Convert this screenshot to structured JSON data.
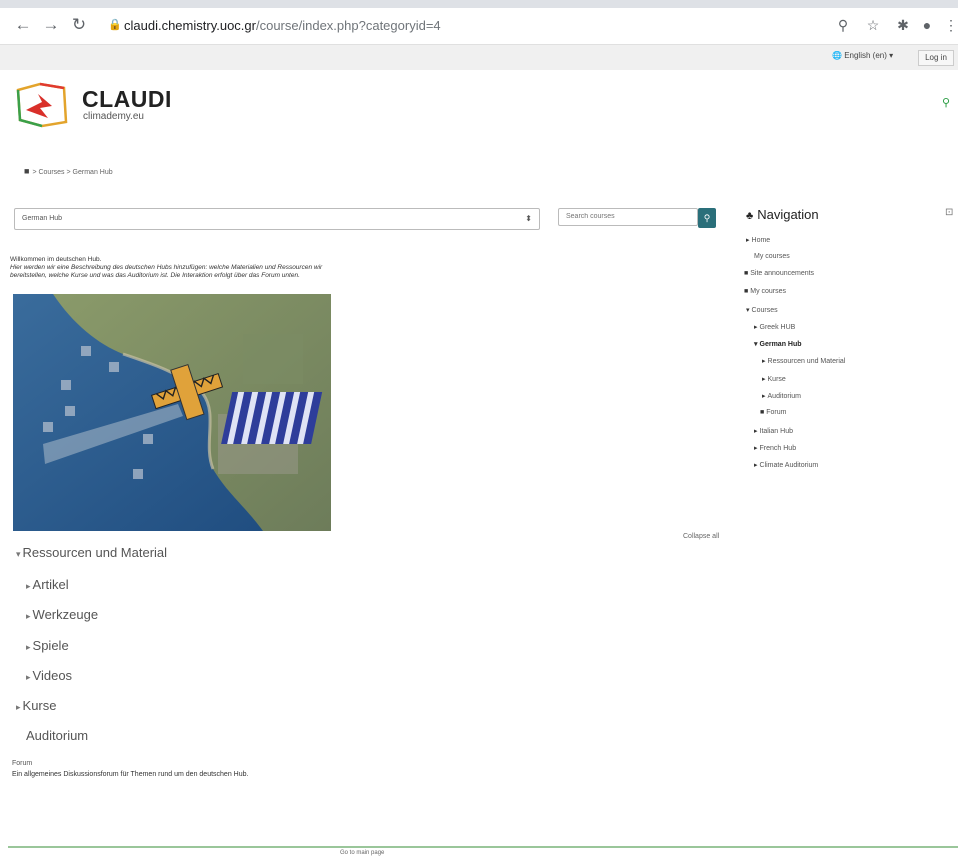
{
  "browser": {
    "url_host": "claudi.chemistry.uoc.gr",
    "url_path": "/course/index.php?categoryid=4"
  },
  "topbar": {
    "language": "English (en)",
    "login": "Log in"
  },
  "logo": {
    "title": "CLAUDI",
    "subtitle": "climademy.eu"
  },
  "breadcrumb": {
    "courses": "Courses",
    "current": "German Hub"
  },
  "category_select": {
    "value": "German Hub"
  },
  "course_search": {
    "placeholder": "Search courses"
  },
  "summary": {
    "line1": "Willkommen im deutschen Hub.",
    "line2": "Hier werden wir eine Beschreibung des deutschen Hubs hinzufügen: welche Materialien und Ressourcen wir",
    "line3": "bereitstellen, welche Kurse und was das Auditorium ist. Die Interaktion erfolgt über das Forum unten."
  },
  "collapse_all": "Collapse all",
  "sections": [
    {
      "label": "Ressourcen und Material",
      "toggle": "▾"
    },
    {
      "label": "Artikel",
      "toggle": "▸"
    },
    {
      "label": "Werkzeuge",
      "toggle": "▸"
    },
    {
      "label": "Spiele",
      "toggle": "▸"
    },
    {
      "label": "Videos",
      "toggle": "▸"
    },
    {
      "label": "Kurse",
      "toggle": "▸"
    },
    {
      "label": "Auditorium",
      "toggle": ""
    }
  ],
  "forum": {
    "label": "Forum",
    "description": "Ein allgemeines Diskussionsforum für Themen rund um den deutschen Hub."
  },
  "footer": {
    "text": "Go to main page"
  },
  "navigation": {
    "title": "Navigation",
    "items": [
      {
        "label": "Home",
        "prefix": "▸"
      },
      {
        "label": "My courses",
        "prefix": ""
      },
      {
        "label": "Site announcements",
        "prefix": "■"
      },
      {
        "label": "My courses",
        "prefix": "■"
      },
      {
        "label": "Courses",
        "prefix": "▾"
      },
      {
        "label": "Greek HUB",
        "prefix": "▸"
      },
      {
        "label": "German Hub",
        "prefix": "▾"
      },
      {
        "label": "Ressourcen und Material",
        "prefix": "▸"
      },
      {
        "label": "Kurse",
        "prefix": "▸"
      },
      {
        "label": "Auditorium",
        "prefix": "▸"
      },
      {
        "label": "Forum",
        "prefix": "■"
      },
      {
        "label": "Italian Hub",
        "prefix": "▸"
      },
      {
        "label": "French Hub",
        "prefix": "▸"
      },
      {
        "label": "Climate Auditorium",
        "prefix": "▸"
      }
    ]
  },
  "colors": {
    "accent": "#2a9d43",
    "search_button": "#2a6f7a"
  }
}
